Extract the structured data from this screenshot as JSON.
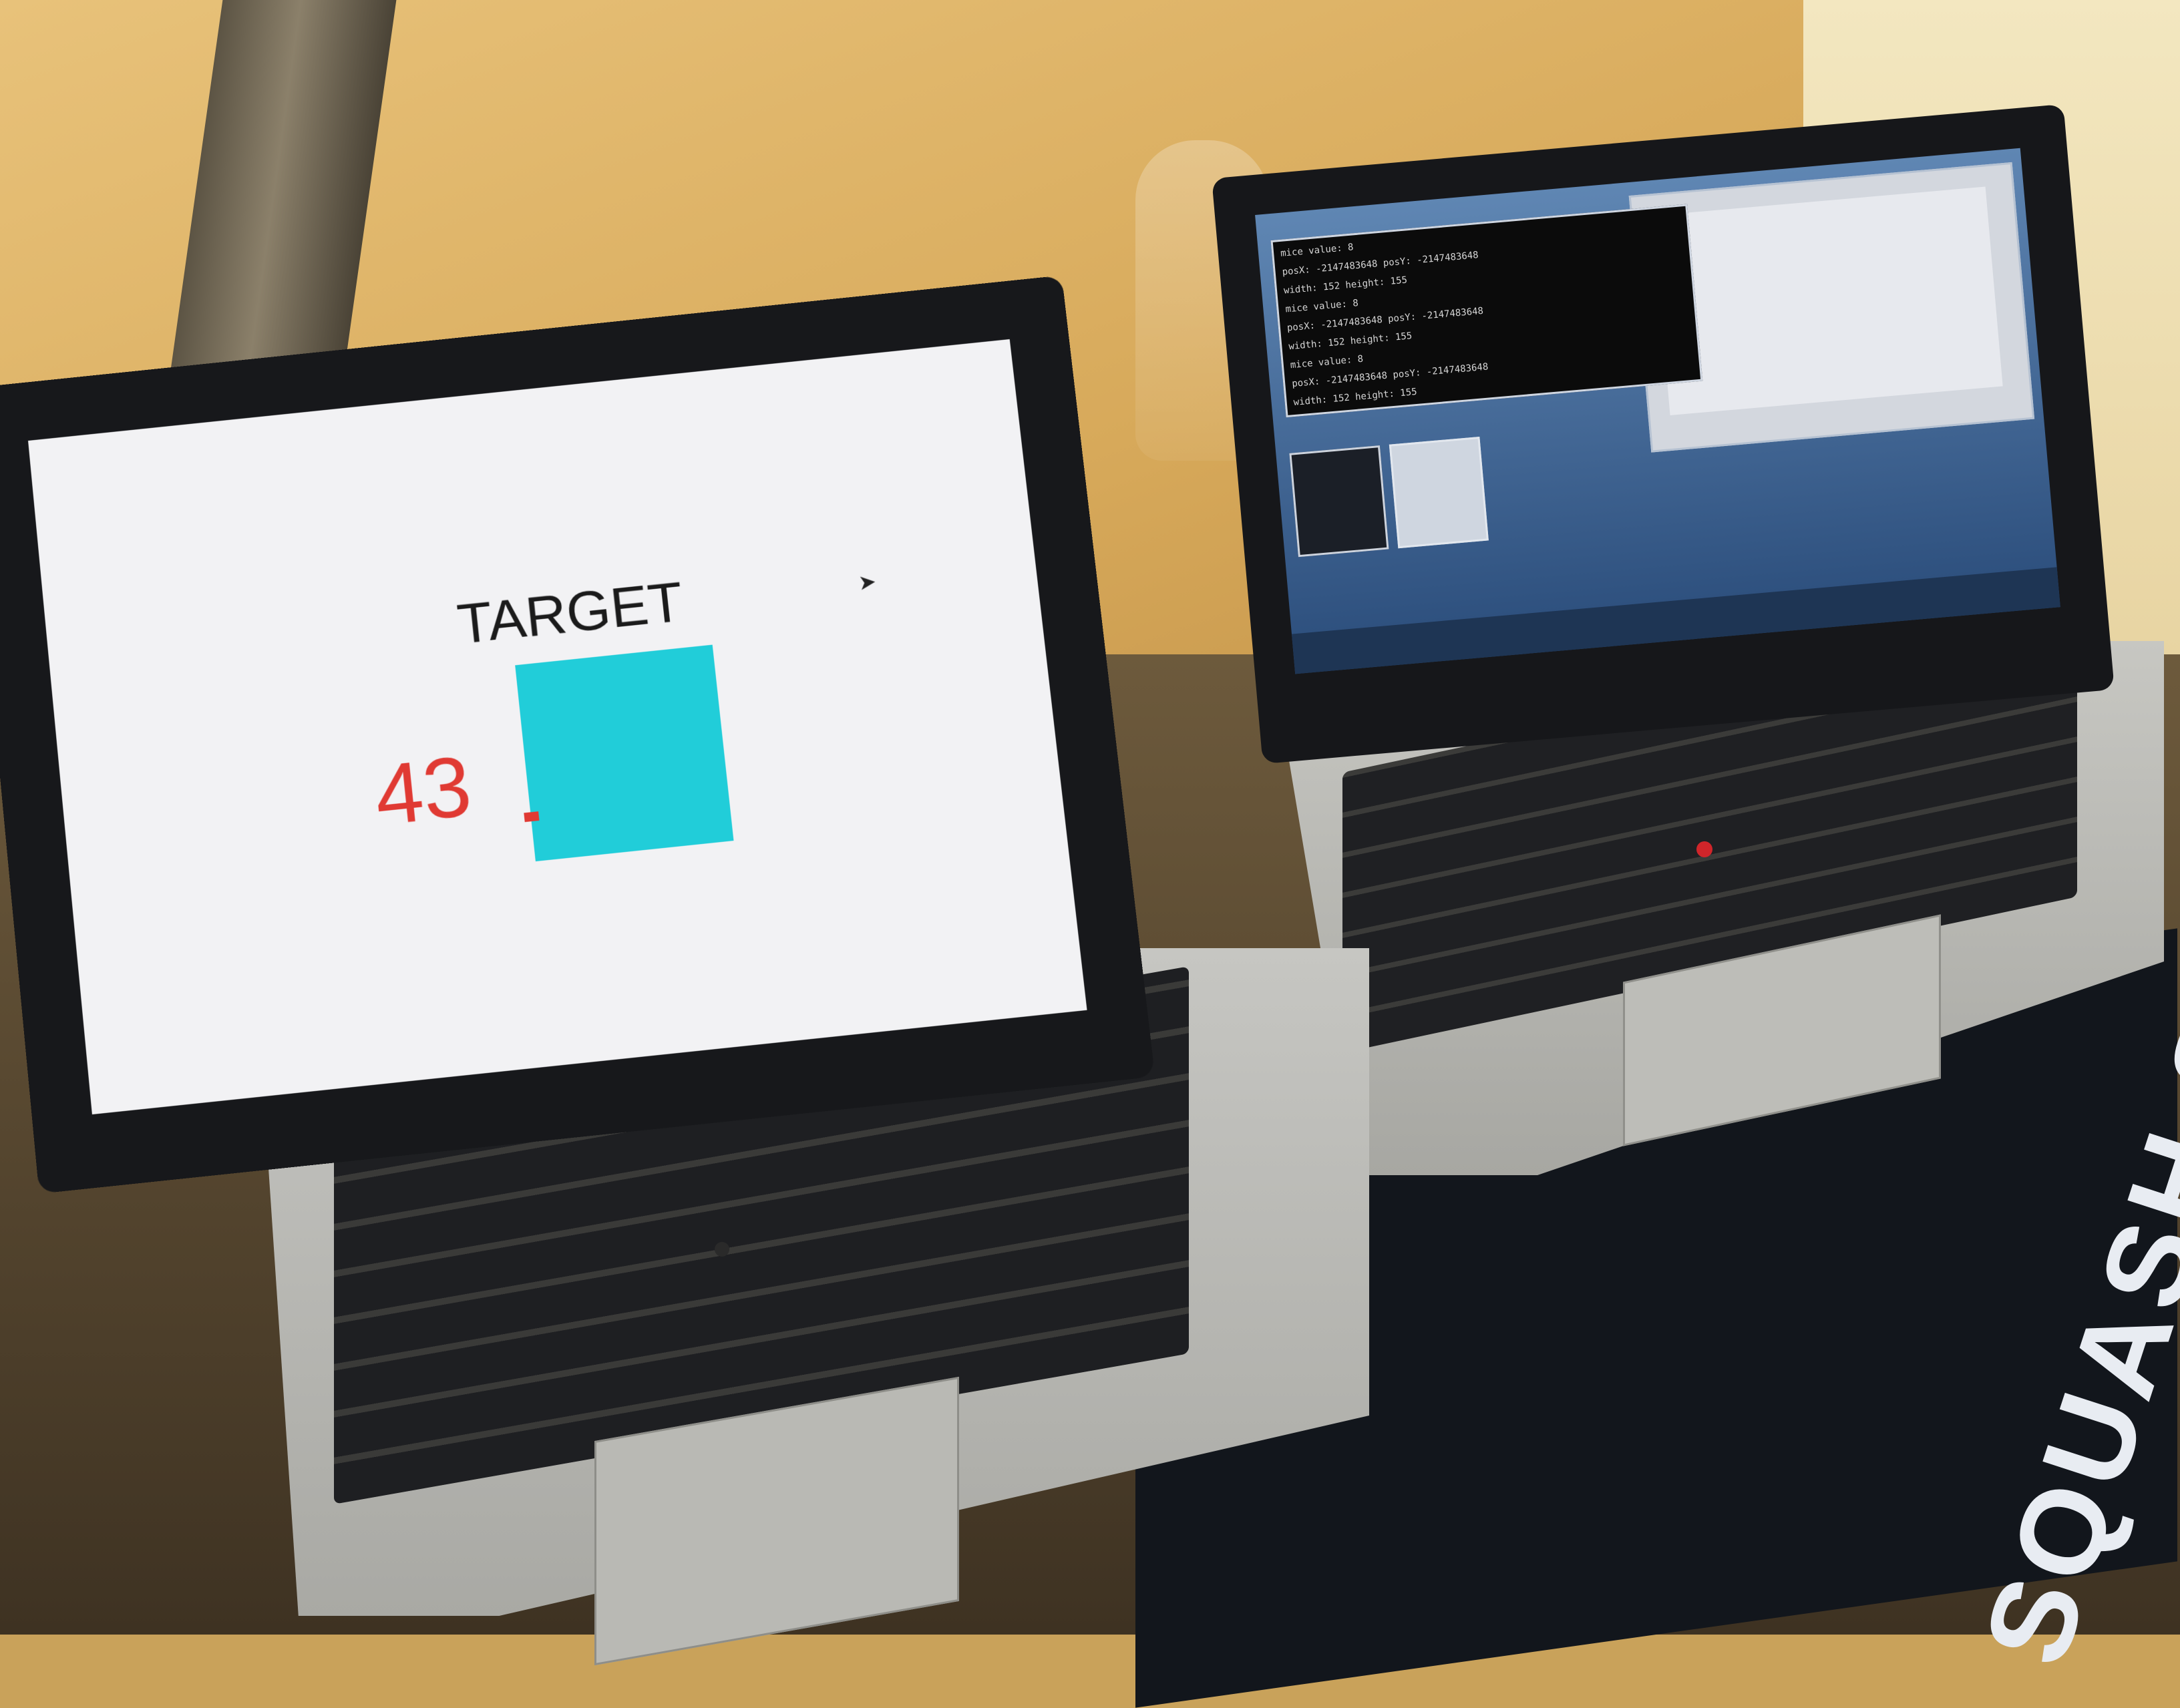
{
  "scene": {
    "left_laptop_screen": {
      "title": "TARGET",
      "counter": "43"
    },
    "right_laptop_screen": {
      "console_lines": [
        "mice value: 8",
        "posX: -2147483648  posY: -2147483648",
        "width: 152 height: 155",
        "mice value: 8",
        "posX: -2147483648  posY: -2147483648",
        "width: 152 height: 155",
        "mice value: 8",
        "posX: -2147483648  posY: -2147483648",
        "width: 152 height: 155"
      ]
    },
    "poster_text": "SQUASH SM"
  },
  "colors": {
    "target_square": "#21cdd9",
    "counter": "#e03a33"
  }
}
